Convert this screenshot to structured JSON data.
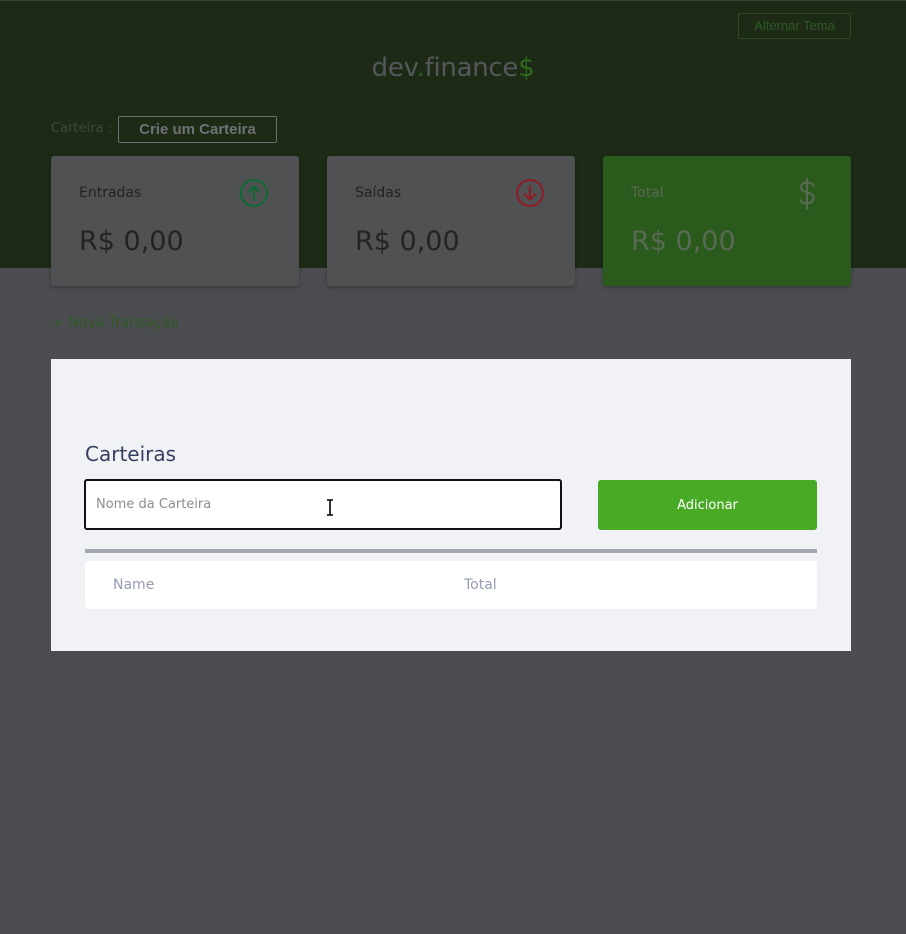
{
  "header": {
    "toggle_theme_label": "Alternar Tema",
    "logo": {
      "part1": "dev",
      "dot": ".",
      "part2": "finance",
      "dollar": "$"
    },
    "wallet_label": "Carteira :",
    "wallet_button_label": "Crie um Carteira"
  },
  "cards": {
    "income": {
      "label": "Entradas",
      "value": "R$ 0,00",
      "icon": "arrow-up-circle-icon"
    },
    "expense": {
      "label": "Saídas",
      "value": "R$ 0,00",
      "icon": "arrow-down-circle-icon"
    },
    "total": {
      "label": "Total",
      "value": "R$ 0,00",
      "icon": "dollar-icon"
    }
  },
  "new_transaction_label": "+ Nova Transação",
  "modal": {
    "title": "Carteiras",
    "input_placeholder": "Nome da Carteira",
    "input_value": "",
    "add_button_label": "Adicionar",
    "table_headers": [
      "Name",
      "Total"
    ]
  },
  "colors": {
    "header_bg": "#1c2a16",
    "accent_green": "#49aa26",
    "income_icon": "#12a454",
    "expense_icon": "#e92929",
    "overlay_bg": "#4c4d50"
  }
}
